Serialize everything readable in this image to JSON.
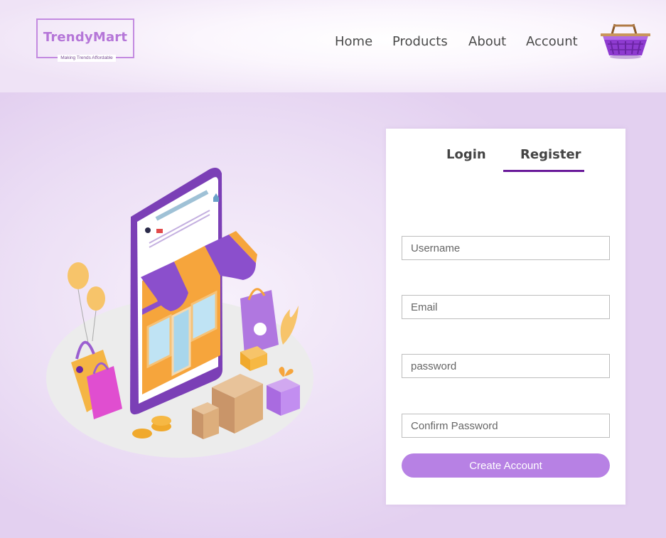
{
  "brand": {
    "name": "TrendyMart",
    "tagline": "Making Trends Affordable"
  },
  "nav": {
    "links": [
      "Home",
      "Products",
      "About",
      "Account"
    ]
  },
  "cart": {
    "icon": "basket-icon"
  },
  "auth": {
    "tabs": {
      "login": "Login",
      "register": "Register"
    },
    "active_tab": "Register",
    "fields": {
      "username": {
        "placeholder": "Username",
        "value": ""
      },
      "email": {
        "placeholder": "Email",
        "value": ""
      },
      "password": {
        "placeholder": "password",
        "value": ""
      },
      "confirm": {
        "placeholder": "Confirm Password",
        "value": ""
      }
    },
    "submit_label": "Create Account"
  },
  "colors": {
    "brand": "#b576d8",
    "accent": "#6a1b9a",
    "button": "#b781e4"
  }
}
